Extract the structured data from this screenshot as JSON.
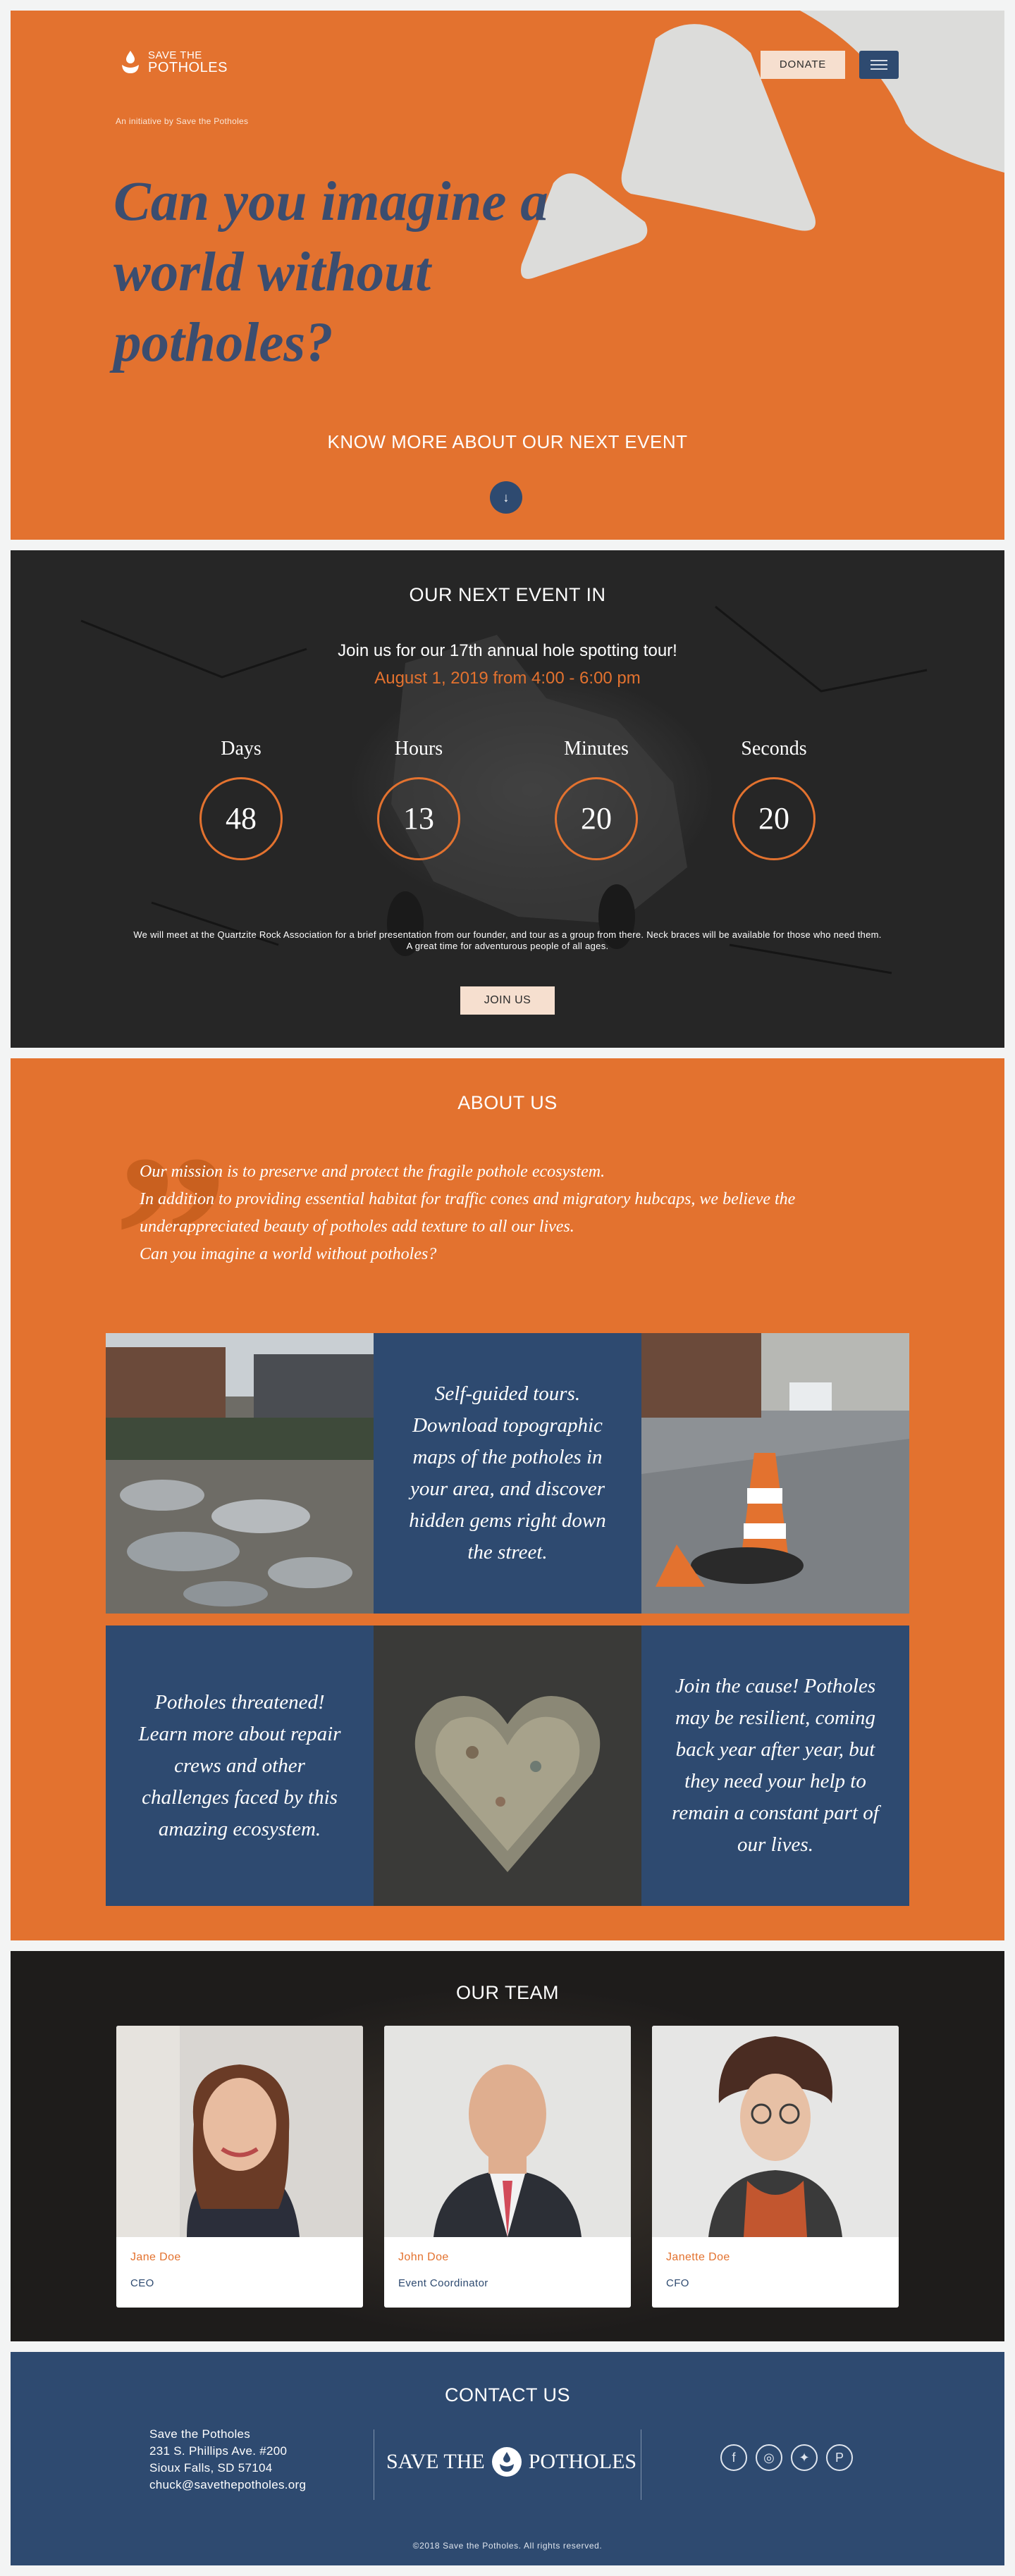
{
  "header": {
    "logo_line1": "SAVE THE",
    "logo_line2": "POTHOLES",
    "donate_label": "DONATE",
    "menu_icon": "hamburger-menu-icon"
  },
  "hero": {
    "initiative": "An initiative by Save the Potholes",
    "headline": "Can you imagine a world without potholes?",
    "know_more": "KNOW MORE ABOUT OUR NEXT EVENT",
    "down_arrow": "↓"
  },
  "event": {
    "title": "OUR NEXT EVENT IN",
    "intro": "Join us for our 17th annual hole spotting tour!",
    "date": "August 1, 2019 from 4:00 - 6:00 pm",
    "countdown": [
      {
        "label": "Days",
        "value": "48"
      },
      {
        "label": "Hours",
        "value": "13"
      },
      {
        "label": "Minutes",
        "value": "20"
      },
      {
        "label": "Seconds",
        "value": "20"
      }
    ],
    "description_1": "We will meet at the Quartzite Rock Association for a brief presentation from our founder, and tour as a group from there. Neck braces will be available for those who need them.",
    "description_2": "A great time for adventurous people of all ages.",
    "join_label": "JOIN US"
  },
  "about": {
    "title": "ABOUT US",
    "quote_mark": "”",
    "mission_1": "Our mission is to preserve and protect the fragile pothole ecosystem.",
    "mission_2": "In addition to providing essential habitat for traffic cones and migratory hubcaps, we believe the underappreciated beauty of potholes add texture to all our lives.",
    "mission_3": "Can you imagine a world without potholes?",
    "tile_tours": "Self-guided tours. Download topographic maps of the potholes in your area, and discover hidden gems right down the street.",
    "tile_threatened": "Potholes threatened! Learn more about repair crews and other challenges faced by this amazing ecosystem.",
    "tile_cause": "Join the cause! Potholes may be resilient, coming back year after year, but they need your help to remain a constant part of our lives."
  },
  "team": {
    "title": "OUR TEAM",
    "members": [
      {
        "name": "Jane Doe",
        "role": "CEO"
      },
      {
        "name": "John Doe",
        "role": "Event Coordinator"
      },
      {
        "name": "Janette Doe",
        "role": "CFO"
      }
    ]
  },
  "contact": {
    "title": "CONTACT US",
    "org": "Save the Potholes",
    "street": "231 S. Phillips Ave. #200",
    "city": "Sioux Falls, SD 57104",
    "email": "chuck@savethepotholes.org",
    "logo_left": "SAVE THE",
    "logo_right": "POTHOLES",
    "social_icons": [
      "facebook-icon",
      "instagram-icon",
      "twitter-icon",
      "pinterest-icon"
    ],
    "copyright": "©2018 Save the Potholes. All rights reserved."
  },
  "colors": {
    "orange": "#e3722f",
    "navy": "#2e4a70",
    "cream": "#f6dfcf"
  }
}
